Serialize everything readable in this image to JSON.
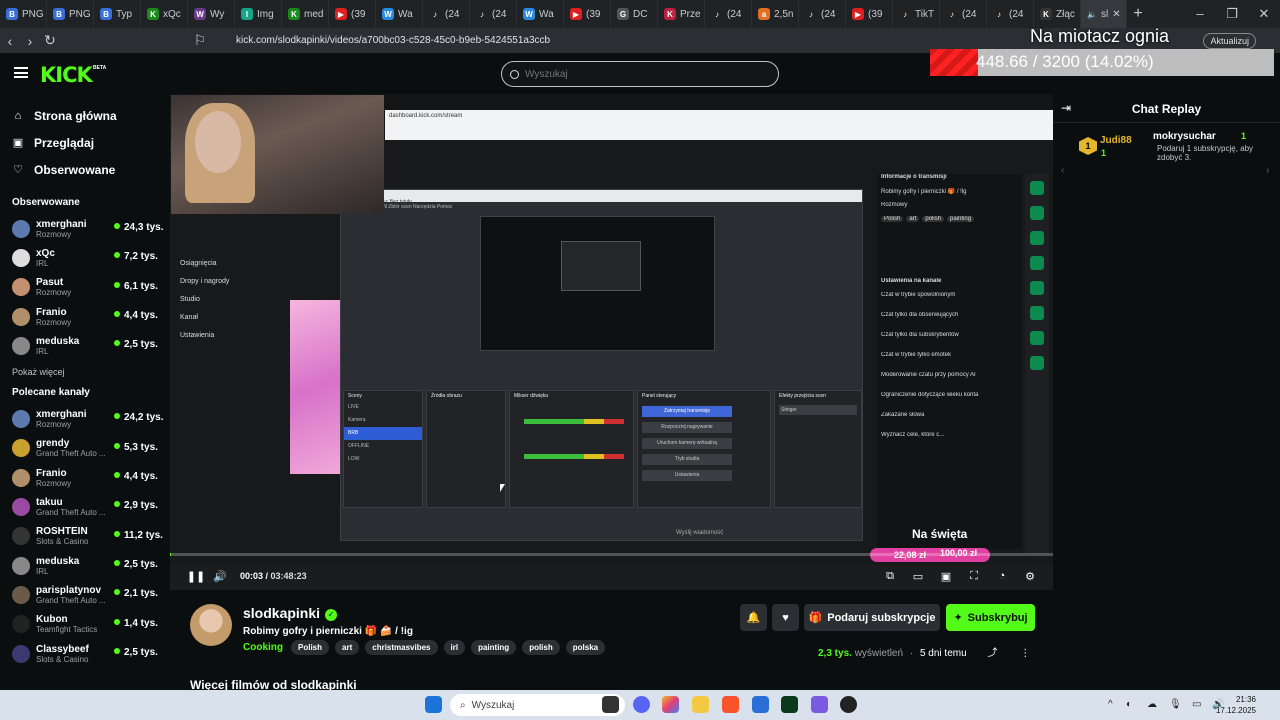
{
  "browser": {
    "tabs": [
      {
        "label": "PNG",
        "fav": "B",
        "color": "#3a6fd8"
      },
      {
        "label": "PNG",
        "fav": "B",
        "color": "#3a6fd8"
      },
      {
        "label": "Typ",
        "fav": "B",
        "color": "#3a6fd8"
      },
      {
        "label": "xQc",
        "fav": "K",
        "color": "#1a8a1a"
      },
      {
        "label": "Wy",
        "fav": "W",
        "color": "#6a3a8a"
      },
      {
        "label": "Img",
        "fav": "I",
        "color": "#17a589"
      },
      {
        "label": "med",
        "fav": "K",
        "color": "#1a8a1a"
      },
      {
        "label": "(39",
        "fav": "▶",
        "color": "#e02020"
      },
      {
        "label": "Wa",
        "fav": "W",
        "color": "#2a8ae0"
      },
      {
        "label": "(24",
        "fav": "♪",
        "color": "#222"
      },
      {
        "label": "(24",
        "fav": "♪",
        "color": "#222"
      },
      {
        "label": "Wa",
        "fav": "W",
        "color": "#2a8ae0"
      },
      {
        "label": "(39",
        "fav": "▶",
        "color": "#e02020"
      },
      {
        "label": "DC",
        "fav": "G",
        "color": "#555"
      },
      {
        "label": "Prze",
        "fav": "K",
        "color": "#c02040"
      },
      {
        "label": "(24",
        "fav": "♪",
        "color": "#222"
      },
      {
        "label": "2,5n",
        "fav": "a",
        "color": "#e07020"
      },
      {
        "label": "(24",
        "fav": "♪",
        "color": "#222"
      },
      {
        "label": "(39",
        "fav": "▶",
        "color": "#e02020"
      },
      {
        "label": "TikT",
        "fav": "♪",
        "color": "#222"
      },
      {
        "label": "(24",
        "fav": "♪",
        "color": "#222"
      },
      {
        "label": "(24",
        "fav": "♪",
        "color": "#222"
      },
      {
        "label": "Złąc",
        "fav": "K",
        "color": "#333"
      }
    ],
    "active_tab_label": "sl",
    "url": "kick.com/slodkapinki/videos/a700bc03-c528-45c0-b9eb-5424551a3ccb",
    "update_label": "Aktualizuj"
  },
  "overlay": {
    "title": "Na miotacz ognia",
    "progress_text": "448.66 / 3200 (14.02%)",
    "progress_fraction": 0.1402
  },
  "header": {
    "logo": "KICK",
    "logo_beta": "BETA",
    "search_placeholder": "Wyszukaj"
  },
  "sidebar": {
    "nav": [
      {
        "label": "Strona główna",
        "icon": "⌂"
      },
      {
        "label": "Przeglądaj",
        "icon": "▣"
      },
      {
        "label": "Obserwowane",
        "icon": "♡"
      }
    ],
    "followed_title": "Obserwowane",
    "followed": [
      {
        "name": "xmerghani",
        "category": "Rozmowy",
        "viewers": "24,3 tys.",
        "color": "#5a7ab0"
      },
      {
        "name": "xQc",
        "category": "IRL",
        "viewers": "7,2 tys.",
        "color": "#ddd"
      },
      {
        "name": "Pasut",
        "category": "Rozmowy",
        "viewers": "6,1 tys.",
        "color": "#c49070"
      },
      {
        "name": "Franio",
        "category": "Rozmowy",
        "viewers": "4,4 tys.",
        "color": "#b0906a"
      },
      {
        "name": "meduska",
        "category": "IRL",
        "viewers": "2,5 tys.",
        "color": "#888"
      }
    ],
    "show_more": "Pokaż więcej",
    "recommended_title": "Polecane kanały",
    "recommended": [
      {
        "name": "xmerghani",
        "category": "Rozmowy",
        "viewers": "24,2 tys.",
        "color": "#5a7ab0"
      },
      {
        "name": "grendy",
        "category": "Grand Theft Auto ...",
        "viewers": "5,3 tys.",
        "color": "#c8a030"
      },
      {
        "name": "Franio",
        "category": "Rozmowy",
        "viewers": "4,4 tys.",
        "color": "#b0906a"
      },
      {
        "name": "takuu",
        "category": "Grand Theft Auto ...",
        "viewers": "2,9 tys.",
        "color": "#9a4aa0"
      },
      {
        "name": "ROSHTEIN",
        "category": "Slots & Casino",
        "viewers": "11,2 tys.",
        "color": "#333"
      },
      {
        "name": "meduska",
        "category": "IRL",
        "viewers": "2,5 tys.",
        "color": "#888"
      },
      {
        "name": "parisplatynov",
        "category": "Grand Theft Auto ...",
        "viewers": "2,1 tys.",
        "color": "#6a5a4a"
      },
      {
        "name": "Kubon",
        "category": "Teamfight Tactics",
        "viewers": "1,4 tys.",
        "color": "#222"
      },
      {
        "name": "Classybeef",
        "category": "Slots & Casino",
        "viewers": "2,5 tys.",
        "color": "#3a3a70"
      }
    ]
  },
  "video_content": {
    "obs_title": "Profil: paja - Sceny: Bez tytułu",
    "obs_menu": "Wideo  Panele  Profil  Zbiór scen  Narzędzia  Pomoc",
    "obs_url": "dashboard.kick.com/stream",
    "left_menu": [
      "Osiągnięcia",
      "Dropy i nagrody",
      "Studio",
      "Kanał",
      "Ustawienia"
    ],
    "scenes_title": "Sceny",
    "scenes": [
      "LIVE",
      "Kamera",
      "BRB",
      "OFFLINE",
      "LOW"
    ],
    "selected_scene": "BRB",
    "sources_title": "Źródła obrazu",
    "mixer_title": "Mikser dźwięku",
    "controls_title": "Panel sterujący",
    "transitions_title": "Efekty przejścia scen",
    "obs_buttons": [
      "Zatrzymaj transmisję",
      "Rozpocznij nagrywanie",
      "Uruchom kamerę wirtualną",
      "Tryb studia",
      "Ustawienia"
    ],
    "transition_value": "Stinger",
    "right_panel_title": "Informacje o transmisji",
    "stream_title": "Robimy gofry i pierniczki 🎁 / !lg",
    "stream_category": "Rozmowy",
    "stream_tags": [
      "Polish",
      "art",
      "polish",
      "painting"
    ],
    "chat_settings_title": "Ustawienia na kanale",
    "chat_settings": [
      "Czat w trybie spowolnionym",
      "Czat tylko dla obserwujących",
      "Czat tylko dla subskrybentów",
      "Czat w trybie tylko emotek",
      "Moderowanie czatu przy pomocy AI",
      "Ograniczenie dotyczące wieku konta",
      "Zakazane słowa",
      "Wyznacz cele, które c..."
    ],
    "naswieta": "Na święta",
    "price_1": "22,08 zł",
    "price_2": "100,00 zł",
    "message_placeholder": "Wyślij wiadomość"
  },
  "player": {
    "current_time": "00:03",
    "duration": "03:48:23",
    "progress_fraction": 0.0002
  },
  "streamer": {
    "name": "slodkapinki",
    "title": "Robimy gofry i pierniczki 🎁 🍰 / !ig",
    "category": "Cooking",
    "tags": [
      "Polish",
      "art",
      "christmasvibes",
      "irl",
      "painting",
      "polish",
      "polska"
    ],
    "gift_sub_label": "Podaruj subskrypcje",
    "subscribe_label": "Subskrybuj",
    "views": "2,3 tys.",
    "views_label": "wyświetleń",
    "ago": "5 dni temu",
    "more_films": "Więcej filmów od slodkapinki"
  },
  "chat": {
    "title": "Chat Replay",
    "gift": {
      "gifter": "Judi88",
      "gifter_count": "1",
      "recipient": "mokrysuchar",
      "recipient_count": "1",
      "message": "Podaruj 1 subskrypcję, aby zdobyć 3."
    }
  },
  "taskbar": {
    "search_placeholder": "Wyszukaj",
    "time": "21:36",
    "date": "17.12.2025"
  }
}
